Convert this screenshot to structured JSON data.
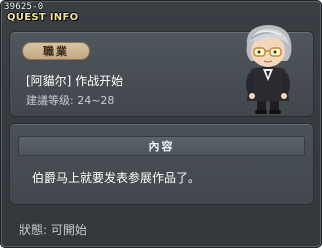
{
  "window": {
    "quest_id": "39625-0",
    "title": "QUEST INFO"
  },
  "quest": {
    "job_badge": "職業",
    "name": "[阿貓尔] 作战开始",
    "required_level": "建議等级: 24~28",
    "character_portrait": "gray-haired-man-with-glasses-icon"
  },
  "content": {
    "header": "內容",
    "text": "伯爵马上就要发表参展作品了。"
  },
  "status": {
    "text": "狀態: 可開始"
  },
  "colors": {
    "title_accent": "#f2e2a0",
    "badge_bg": "#d0b893",
    "panel_bg": "#4a5157",
    "window_bg": "#373c40"
  }
}
